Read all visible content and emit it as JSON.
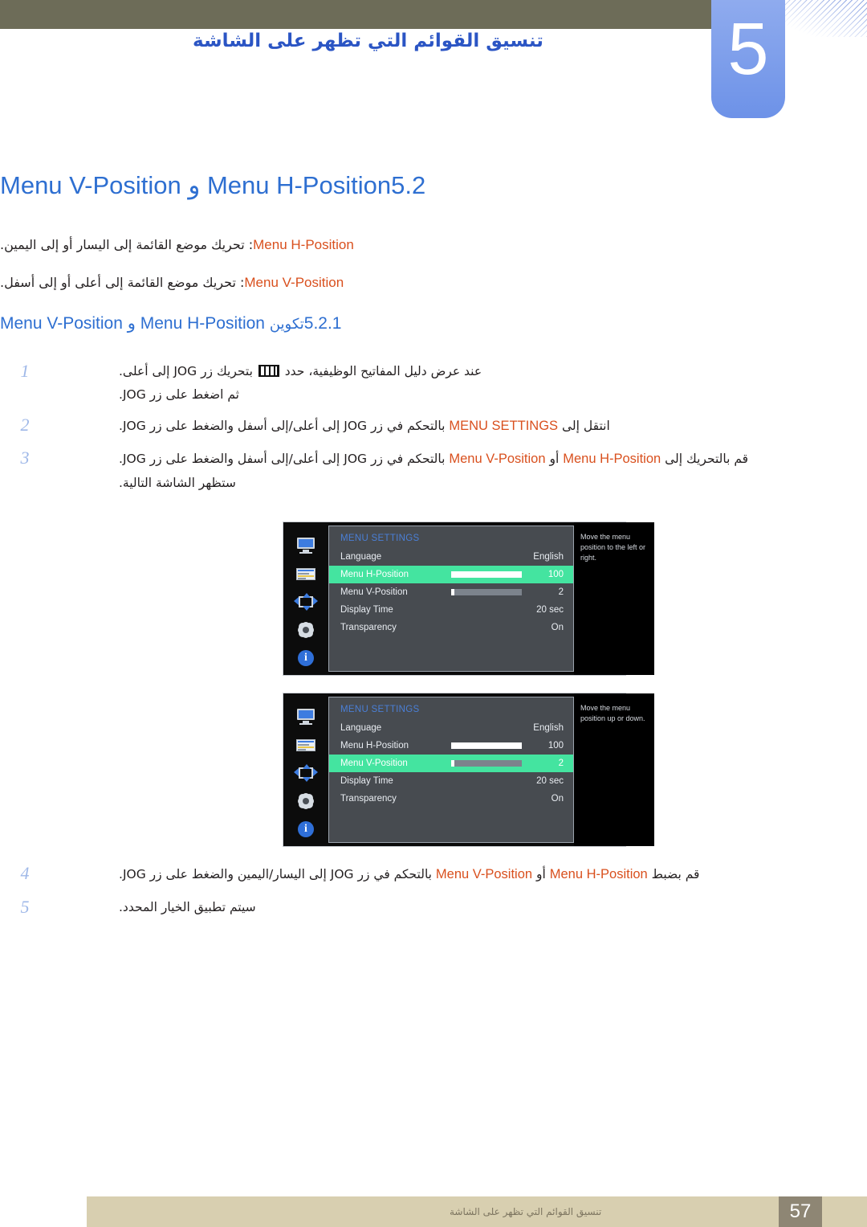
{
  "header": {
    "chapter_number": "5",
    "chapter_title": "تنسيق القوائم التي تظهر على الشاشة"
  },
  "section": {
    "number": "5.2",
    "title": "Menu H-Position و Menu V-Position",
    "bullets": [
      {
        "term": "Menu H-Position",
        "text": ": تحريك موضع القائمة إلى اليسار أو إلى اليمين."
      },
      {
        "term": "Menu V-Position",
        "text": ": تحريك موضع القائمة إلى أعلى أو إلى أسفل."
      }
    ]
  },
  "subsection": {
    "number": "5.2.1",
    "title_arabic": "تكوين",
    "title_latin": "Menu H-Position و Menu V-Position"
  },
  "steps": [
    {
      "number": "1",
      "part_a": "عند عرض دليل المفاتيح الوظيفية، حدد",
      "part_b": "بتحريك زر JOG إلى أعلى.",
      "part_c": "ثم اضغط على زر JOG."
    },
    {
      "number": "2",
      "pre": "انتقل إلى",
      "term": "MENU SETTINGS",
      "post": "بالتحكم في زر JOG إلى أعلى/إلى أسفل والضغط على زر JOG."
    },
    {
      "number": "3",
      "pre": "قم بالتحريك إلى",
      "term1": "Menu H-Position",
      "mid": "أو",
      "term2": "Menu V-Position",
      "post": "بالتحكم في زر JOG إلى أعلى/إلى أسفل والضغط على زر JOG.",
      "note": "ستظهر الشاشة التالية."
    },
    {
      "number": "4",
      "pre": "قم بضبط",
      "term1": "Menu H-Position",
      "mid": "أو",
      "term2": "Menu V-Position",
      "post": "بالتحكم في زر JOG إلى اليسار/اليمين والضغط على زر JOG."
    },
    {
      "number": "5",
      "text": "سيتم تطبيق الخيار المحدد."
    }
  ],
  "osd_menus": [
    {
      "title": "MENU SETTINGS",
      "help_text": "Move the menu position to the left or right.",
      "rows": [
        {
          "label": "Language",
          "value": "English",
          "slider": false,
          "selected": false
        },
        {
          "label": "Menu H-Position",
          "value": "100",
          "slider": true,
          "fill_percent": 100,
          "selected": true
        },
        {
          "label": "Menu V-Position",
          "value": "2",
          "slider": true,
          "fill_percent": 5,
          "selected": false
        },
        {
          "label": "Display Time",
          "value": "20 sec",
          "slider": false,
          "selected": false
        },
        {
          "label": "Transparency",
          "value": "On",
          "slider": false,
          "selected": false
        }
      ]
    },
    {
      "title": "MENU SETTINGS",
      "help_text": "Move the menu position up or down.",
      "rows": [
        {
          "label": "Language",
          "value": "English",
          "slider": false,
          "selected": false
        },
        {
          "label": "Menu H-Position",
          "value": "100",
          "slider": true,
          "fill_percent": 100,
          "selected": false
        },
        {
          "label": "Menu V-Position",
          "value": "2",
          "slider": true,
          "fill_percent": 5,
          "selected": true
        },
        {
          "label": "Display Time",
          "value": "20 sec",
          "slider": false,
          "selected": false
        },
        {
          "label": "Transparency",
          "value": "On",
          "slider": false,
          "selected": false
        }
      ]
    }
  ],
  "osd_rail_icons": [
    "monitor-icon",
    "picture-settings-icon",
    "position-arrows-icon",
    "gear-icon",
    "info-icon"
  ],
  "footer": {
    "page_number": "57",
    "running_title": "تنسيق القوائم التي تظهر على الشاشة"
  },
  "colors": {
    "heading_blue": "#2e6fd1",
    "term_orange": "#d9501e",
    "osd_highlight_green": "#44e4a0",
    "chapter_tab_blue": "#7c9dea",
    "top_bar_olive": "#6d6c58",
    "footer_band": "#d8cfb0",
    "footer_page_box": "#8e8674"
  }
}
